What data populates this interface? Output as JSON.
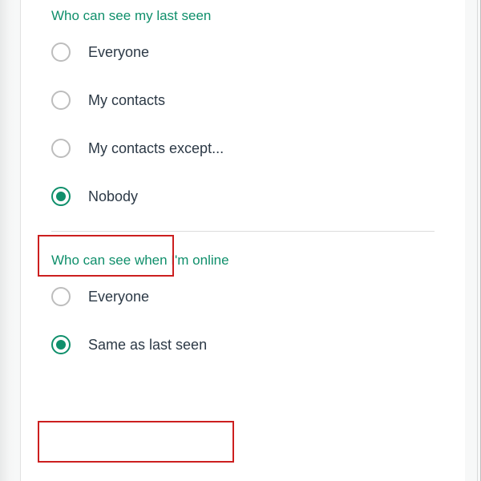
{
  "section1": {
    "title": "Who can see my last seen",
    "options": {
      "everyone": "Everyone",
      "my_contacts": "My contacts",
      "my_contacts_except": "My contacts except...",
      "nobody": "Nobody"
    }
  },
  "section2": {
    "title": "Who can see when I'm online",
    "options": {
      "everyone": "Everyone",
      "same_as_last_seen": "Same as last seen"
    }
  }
}
